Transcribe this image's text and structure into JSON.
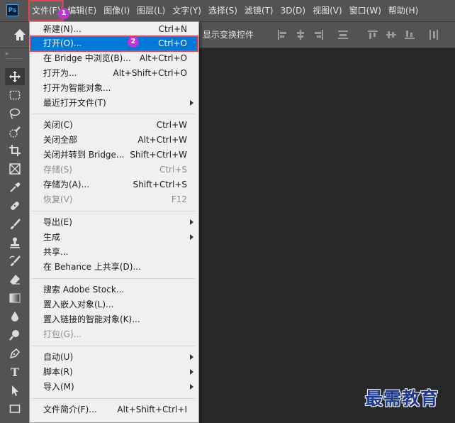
{
  "app": {
    "logo_text": "Ps"
  },
  "menubar": {
    "items": [
      {
        "label": "文件(F)"
      },
      {
        "label": "编辑(E)"
      },
      {
        "label": "图像(I)"
      },
      {
        "label": "图层(L)"
      },
      {
        "label": "文字(Y)"
      },
      {
        "label": "选择(S)"
      },
      {
        "label": "滤镜(T)"
      },
      {
        "label": "3D(D)"
      },
      {
        "label": "视图(V)"
      },
      {
        "label": "窗口(W)"
      },
      {
        "label": "帮助(H)"
      }
    ]
  },
  "options_bar": {
    "show_transform_controls": "显示变换控件"
  },
  "toolbar": {
    "collapse_glyph": "»",
    "type_tool_glyph": "T"
  },
  "badges": {
    "step1": "1",
    "step2": "2"
  },
  "file_menu": {
    "items": [
      {
        "label": "新建(N)...",
        "shortcut": "Ctrl+N"
      },
      {
        "label": "打开(O)...",
        "shortcut": "Ctrl+O"
      },
      {
        "label": "在 Bridge 中浏览(B)...",
        "shortcut": "Alt+Ctrl+O"
      },
      {
        "label": "打开为...",
        "shortcut": "Alt+Shift+Ctrl+O"
      },
      {
        "label": "打开为智能对象...",
        "shortcut": ""
      },
      {
        "label": "最近打开文件(T)",
        "shortcut": ""
      },
      {
        "label": "关闭(C)",
        "shortcut": "Ctrl+W"
      },
      {
        "label": "关闭全部",
        "shortcut": "Alt+Ctrl+W"
      },
      {
        "label": "关闭并转到 Bridge...",
        "shortcut": "Shift+Ctrl+W"
      },
      {
        "label": "存储(S)",
        "shortcut": "Ctrl+S"
      },
      {
        "label": "存储为(A)...",
        "shortcut": "Shift+Ctrl+S"
      },
      {
        "label": "恢复(V)",
        "shortcut": "F12"
      },
      {
        "label": "导出(E)",
        "shortcut": ""
      },
      {
        "label": "生成",
        "shortcut": ""
      },
      {
        "label": "共享...",
        "shortcut": ""
      },
      {
        "label": "在 Behance 上共享(D)...",
        "shortcut": ""
      },
      {
        "label": "搜索 Adobe Stock...",
        "shortcut": ""
      },
      {
        "label": "置入嵌入对象(L)...",
        "shortcut": ""
      },
      {
        "label": "置入链接的智能对象(K)...",
        "shortcut": ""
      },
      {
        "label": "打包(G)...",
        "shortcut": ""
      },
      {
        "label": "自动(U)",
        "shortcut": ""
      },
      {
        "label": "脚本(R)",
        "shortcut": ""
      },
      {
        "label": "导入(M)",
        "shortcut": ""
      },
      {
        "label": "文件简介(F)...",
        "shortcut": "Alt+Shift+Ctrl+I"
      }
    ]
  },
  "watermark": {
    "text": "最需教育"
  },
  "colors": {
    "highlight": "#0078d7",
    "annotation_red": "#e8424d",
    "badge_purple": "#c233d6"
  }
}
